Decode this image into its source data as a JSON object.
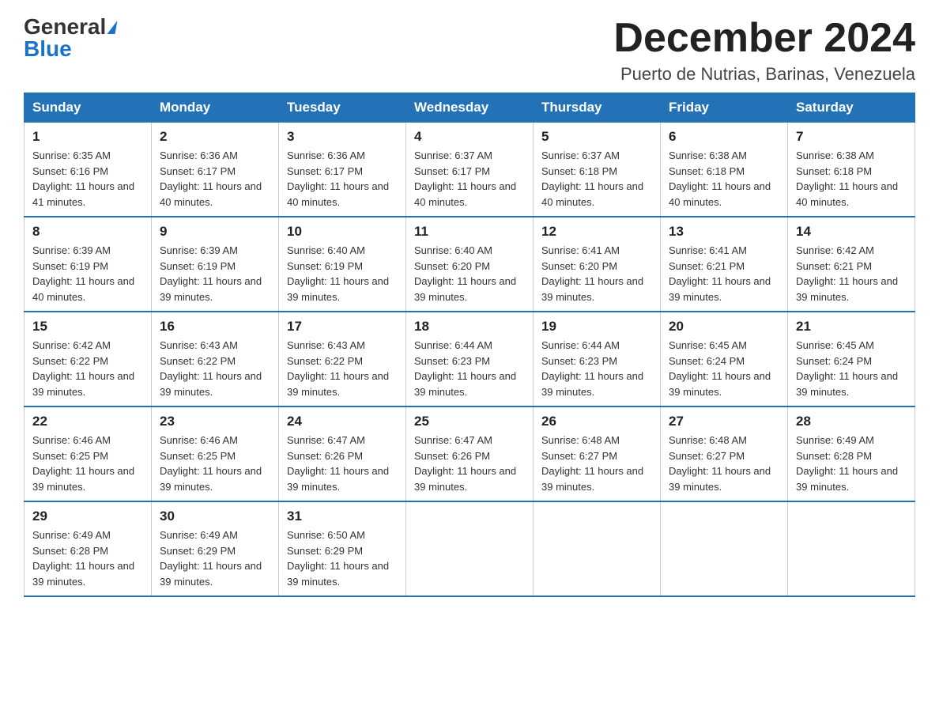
{
  "header": {
    "logo_general": "General",
    "logo_blue": "Blue",
    "month_title": "December 2024",
    "location": "Puerto de Nutrias, Barinas, Venezuela"
  },
  "weekdays": [
    "Sunday",
    "Monday",
    "Tuesday",
    "Wednesday",
    "Thursday",
    "Friday",
    "Saturday"
  ],
  "weeks": [
    [
      {
        "day": "1",
        "sunrise": "6:35 AM",
        "sunset": "6:16 PM",
        "daylight": "11 hours and 41 minutes."
      },
      {
        "day": "2",
        "sunrise": "6:36 AM",
        "sunset": "6:17 PM",
        "daylight": "11 hours and 40 minutes."
      },
      {
        "day": "3",
        "sunrise": "6:36 AM",
        "sunset": "6:17 PM",
        "daylight": "11 hours and 40 minutes."
      },
      {
        "day": "4",
        "sunrise": "6:37 AM",
        "sunset": "6:17 PM",
        "daylight": "11 hours and 40 minutes."
      },
      {
        "day": "5",
        "sunrise": "6:37 AM",
        "sunset": "6:18 PM",
        "daylight": "11 hours and 40 minutes."
      },
      {
        "day": "6",
        "sunrise": "6:38 AM",
        "sunset": "6:18 PM",
        "daylight": "11 hours and 40 minutes."
      },
      {
        "day": "7",
        "sunrise": "6:38 AM",
        "sunset": "6:18 PM",
        "daylight": "11 hours and 40 minutes."
      }
    ],
    [
      {
        "day": "8",
        "sunrise": "6:39 AM",
        "sunset": "6:19 PM",
        "daylight": "11 hours and 40 minutes."
      },
      {
        "day": "9",
        "sunrise": "6:39 AM",
        "sunset": "6:19 PM",
        "daylight": "11 hours and 39 minutes."
      },
      {
        "day": "10",
        "sunrise": "6:40 AM",
        "sunset": "6:19 PM",
        "daylight": "11 hours and 39 minutes."
      },
      {
        "day": "11",
        "sunrise": "6:40 AM",
        "sunset": "6:20 PM",
        "daylight": "11 hours and 39 minutes."
      },
      {
        "day": "12",
        "sunrise": "6:41 AM",
        "sunset": "6:20 PM",
        "daylight": "11 hours and 39 minutes."
      },
      {
        "day": "13",
        "sunrise": "6:41 AM",
        "sunset": "6:21 PM",
        "daylight": "11 hours and 39 minutes."
      },
      {
        "day": "14",
        "sunrise": "6:42 AM",
        "sunset": "6:21 PM",
        "daylight": "11 hours and 39 minutes."
      }
    ],
    [
      {
        "day": "15",
        "sunrise": "6:42 AM",
        "sunset": "6:22 PM",
        "daylight": "11 hours and 39 minutes."
      },
      {
        "day": "16",
        "sunrise": "6:43 AM",
        "sunset": "6:22 PM",
        "daylight": "11 hours and 39 minutes."
      },
      {
        "day": "17",
        "sunrise": "6:43 AM",
        "sunset": "6:22 PM",
        "daylight": "11 hours and 39 minutes."
      },
      {
        "day": "18",
        "sunrise": "6:44 AM",
        "sunset": "6:23 PM",
        "daylight": "11 hours and 39 minutes."
      },
      {
        "day": "19",
        "sunrise": "6:44 AM",
        "sunset": "6:23 PM",
        "daylight": "11 hours and 39 minutes."
      },
      {
        "day": "20",
        "sunrise": "6:45 AM",
        "sunset": "6:24 PM",
        "daylight": "11 hours and 39 minutes."
      },
      {
        "day": "21",
        "sunrise": "6:45 AM",
        "sunset": "6:24 PM",
        "daylight": "11 hours and 39 minutes."
      }
    ],
    [
      {
        "day": "22",
        "sunrise": "6:46 AM",
        "sunset": "6:25 PM",
        "daylight": "11 hours and 39 minutes."
      },
      {
        "day": "23",
        "sunrise": "6:46 AM",
        "sunset": "6:25 PM",
        "daylight": "11 hours and 39 minutes."
      },
      {
        "day": "24",
        "sunrise": "6:47 AM",
        "sunset": "6:26 PM",
        "daylight": "11 hours and 39 minutes."
      },
      {
        "day": "25",
        "sunrise": "6:47 AM",
        "sunset": "6:26 PM",
        "daylight": "11 hours and 39 minutes."
      },
      {
        "day": "26",
        "sunrise": "6:48 AM",
        "sunset": "6:27 PM",
        "daylight": "11 hours and 39 minutes."
      },
      {
        "day": "27",
        "sunrise": "6:48 AM",
        "sunset": "6:27 PM",
        "daylight": "11 hours and 39 minutes."
      },
      {
        "day": "28",
        "sunrise": "6:49 AM",
        "sunset": "6:28 PM",
        "daylight": "11 hours and 39 minutes."
      }
    ],
    [
      {
        "day": "29",
        "sunrise": "6:49 AM",
        "sunset": "6:28 PM",
        "daylight": "11 hours and 39 minutes."
      },
      {
        "day": "30",
        "sunrise": "6:49 AM",
        "sunset": "6:29 PM",
        "daylight": "11 hours and 39 minutes."
      },
      {
        "day": "31",
        "sunrise": "6:50 AM",
        "sunset": "6:29 PM",
        "daylight": "11 hours and 39 minutes."
      },
      null,
      null,
      null,
      null
    ]
  ]
}
